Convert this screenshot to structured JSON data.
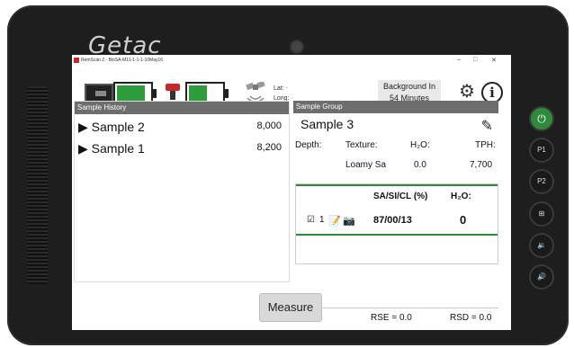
{
  "window": {
    "title": "RemScan 2 - BioSA-M11-1-1-1-10May16"
  },
  "bezel": {
    "brand": "Getac"
  },
  "status": {
    "lat_label": "Lat:",
    "long_label": "Long:",
    "background_label": "Background In",
    "background_value": "54 Minutes",
    "battery_levels": [
      0.85,
      0.55
    ],
    "colors": {
      "battery_fill": "#2e9b3c"
    }
  },
  "history": {
    "header": "Sample History",
    "items": [
      {
        "label": "Sample 2",
        "value": "8,000"
      },
      {
        "label": "Sample 1",
        "value": "8,200"
      }
    ]
  },
  "group": {
    "header": "Sample Group",
    "title": "Sample 3",
    "depth_label": "Depth:",
    "texture_label": "Texture:",
    "h2o_label": "H₂O:",
    "tph_label": "TPH:",
    "texture_value": "Loamy Sa",
    "h2o_value": "0.0",
    "tph_value": "7,700",
    "result_header_texture": "SA/SI/CL (%)",
    "result_header_h2o": "H₂O:",
    "result_row_index": "1",
    "result_texture": "87/00/13",
    "result_h2o": "0",
    "rse": "RSE = 0.0",
    "rsd": "RSD = 0.0",
    "colors": {
      "accent": "#2e8b3c"
    }
  },
  "measure": {
    "label": "Measure"
  },
  "side_buttons": [
    "P1",
    "P2"
  ]
}
